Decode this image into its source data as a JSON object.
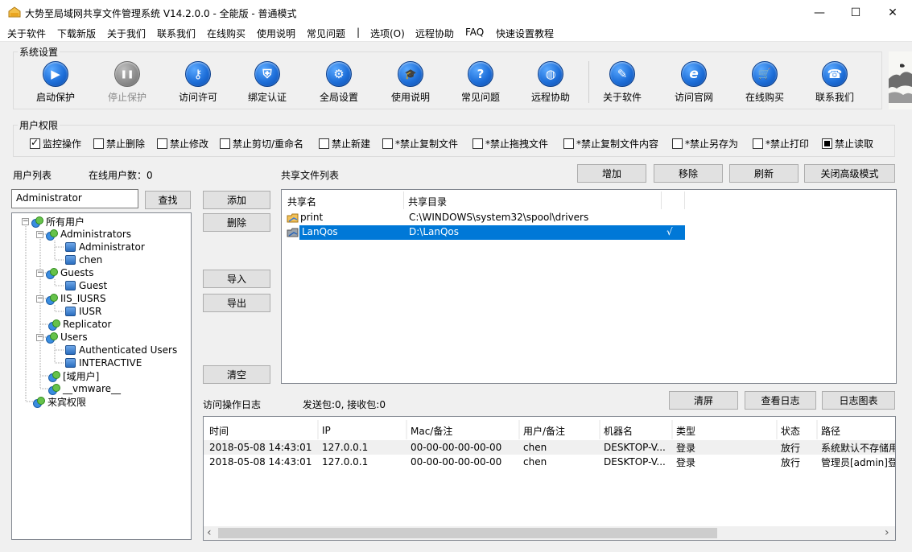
{
  "window": {
    "title": "大势至局域网共享文件管理系统 V14.2.0.0 - 全能版 - 普通模式",
    "minimize": "—",
    "maximize": "☐",
    "close": "✕"
  },
  "menu": [
    "关于软件",
    "下载新版",
    "关于我们",
    "联系我们",
    "在线购买",
    "使用说明",
    "常见问题",
    "|",
    "选项(O)",
    "远程协助",
    "FAQ",
    "快速设置教程"
  ],
  "system_settings": {
    "label": "系统设置",
    "buttons": [
      {
        "label": "启动保护",
        "icon": "play-icon",
        "glyph": "▶",
        "enabled": true
      },
      {
        "label": "停止保护",
        "icon": "pause-icon",
        "glyph": "❚❚",
        "enabled": false
      },
      {
        "label": "访问许可",
        "icon": "key-icon",
        "glyph": "⚷",
        "enabled": true
      },
      {
        "label": "绑定认证",
        "icon": "shield-icon",
        "glyph": "⛨",
        "enabled": true
      },
      {
        "label": "全局设置",
        "icon": "gear-icon",
        "glyph": "⚙",
        "enabled": true
      },
      {
        "label": "使用说明",
        "icon": "graduation-cap-icon",
        "glyph": "🎓",
        "enabled": true
      },
      {
        "label": "常见问题",
        "icon": "question-icon",
        "glyph": "?",
        "enabled": true
      },
      {
        "label": "远程协助",
        "icon": "globe-icon",
        "glyph": "◍",
        "enabled": true
      },
      {
        "label": "关于软件",
        "icon": "document-icon",
        "glyph": "✎",
        "enabled": true
      },
      {
        "label": "访问官网",
        "icon": "browser-e-icon",
        "glyph": "e",
        "enabled": true
      },
      {
        "label": "在线购买",
        "icon": "cart-icon",
        "glyph": "🛒",
        "enabled": true
      },
      {
        "label": "联系我们",
        "icon": "phone-icon",
        "glyph": "☎",
        "enabled": true
      }
    ]
  },
  "permissions": {
    "label": "用户权限",
    "items": [
      {
        "label": "监控操作",
        "state": "checked"
      },
      {
        "label": "禁止删除",
        "state": "unchecked"
      },
      {
        "label": "禁止修改",
        "state": "unchecked"
      },
      {
        "label": "禁止剪切/重命名",
        "state": "unchecked"
      },
      {
        "label": "禁止新建",
        "state": "unchecked"
      },
      {
        "label": "*禁止复制文件",
        "state": "unchecked"
      },
      {
        "label": "*禁止拖拽文件",
        "state": "unchecked"
      },
      {
        "label": "*禁止复制文件内容",
        "state": "unchecked"
      },
      {
        "label": "*禁止另存为",
        "state": "unchecked"
      },
      {
        "label": "*禁止打印",
        "state": "unchecked"
      },
      {
        "label": "禁止读取",
        "state": "indeterminate"
      }
    ]
  },
  "user_list": {
    "label": "用户列表",
    "online_label": "在线用户数：0",
    "search_value": "Administrator",
    "search_button": "查找",
    "tree": [
      {
        "label": "所有用户",
        "type": "group",
        "level": 0,
        "expander": "−"
      },
      {
        "label": "Administrators",
        "type": "group",
        "level": 1,
        "expander": "−"
      },
      {
        "label": "Administrator",
        "type": "user",
        "level": 2
      },
      {
        "label": "chen",
        "type": "user",
        "level": 2
      },
      {
        "label": "Guests",
        "type": "group",
        "level": 1,
        "expander": "−"
      },
      {
        "label": "Guest",
        "type": "user",
        "level": 2
      },
      {
        "label": "IIS_IUSRS",
        "type": "group",
        "level": 1,
        "expander": "−"
      },
      {
        "label": "IUSR",
        "type": "user",
        "level": 2
      },
      {
        "label": "Replicator",
        "type": "group",
        "level": 1
      },
      {
        "label": "Users",
        "type": "group",
        "level": 1,
        "expander": "−"
      },
      {
        "label": "Authenticated Users",
        "type": "user",
        "level": 2
      },
      {
        "label": "INTERACTIVE",
        "type": "user",
        "level": 2
      },
      {
        "label": "[域用户]",
        "type": "group",
        "level": 1
      },
      {
        "label": "__vmware__",
        "type": "group",
        "level": 1
      },
      {
        "label": "来宾权限",
        "type": "group",
        "level": 0
      }
    ]
  },
  "middle_buttons": {
    "add": "添加",
    "delete": "删除",
    "import": "导入",
    "export": "导出",
    "clear": "清空"
  },
  "shared_files": {
    "label": "共享文件列表",
    "buttons": [
      "增加",
      "移除",
      "刷新",
      "关闭高级模式"
    ],
    "columns": [
      "共享名",
      "共享目录"
    ],
    "rows": [
      {
        "name": "print",
        "path": "C:\\WINDOWS\\system32\\spool\\drivers",
        "mark": "",
        "selected": false
      },
      {
        "name": "LanQos",
        "path": "D:\\LanQos",
        "mark": "√",
        "selected": true
      }
    ]
  },
  "log": {
    "label": "访问操作日志",
    "packets": "发送包:0, 接收包:0",
    "buttons": [
      "清屏",
      "查看日志",
      "日志图表"
    ],
    "columns": [
      "时间",
      "IP",
      "Mac/备注",
      "用户/备注",
      "机器名",
      "类型",
      "状态",
      "路径"
    ],
    "rows": [
      [
        "2018-05-08 14:43:01",
        "127.0.0.1",
        "00-00-00-00-00-00",
        "chen",
        "DESKTOP-V...",
        "登录",
        "放行",
        "系统默认不存储用"
      ],
      [
        "2018-05-08 14:43:01",
        "127.0.0.1",
        "00-00-00-00-00-00",
        "chen",
        "DESKTOP-V...",
        "登录",
        "放行",
        "管理员[admin]登"
      ]
    ],
    "scroll_left": "‹",
    "scroll_right": "›"
  }
}
